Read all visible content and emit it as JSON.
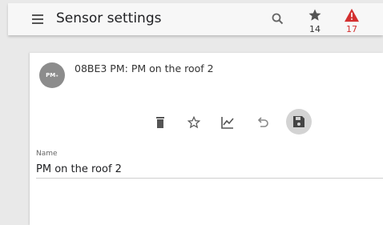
{
  "appbar": {
    "title": "Sensor settings",
    "menu_icon": "menu-icon",
    "search_icon": "search-icon",
    "favorites": {
      "icon": "star-icon",
      "count": "14"
    },
    "alerts": {
      "icon": "warning-icon",
      "count": "17",
      "color": "#d32f2f"
    }
  },
  "card": {
    "avatar_text": "PM₊",
    "title": "08BE3 PM: PM on the roof 2",
    "actions": [
      "delete-icon",
      "star-outline-icon",
      "chart-icon",
      "undo-icon",
      "save-icon"
    ],
    "name_field": {
      "label": "Name",
      "value": "PM on the roof 2"
    }
  }
}
